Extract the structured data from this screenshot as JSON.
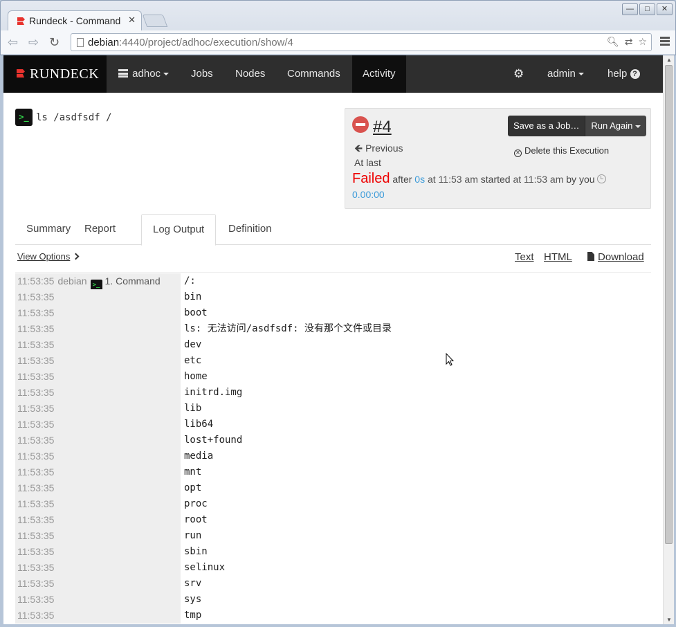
{
  "browser": {
    "tab_title": "Rundeck - Command",
    "url_host": "debian",
    "url_rest": ":4440/project/adhoc/execution/show/4"
  },
  "navbar": {
    "brand": "RUNDECK",
    "project": "adhoc",
    "items": [
      "Jobs",
      "Nodes",
      "Commands",
      "Activity"
    ],
    "admin": "admin",
    "help": "help"
  },
  "command": {
    "icon_text": ">_",
    "text": "ls /asdfsdf /"
  },
  "execution": {
    "number": "#4",
    "previous": "Previous",
    "at_last": "At last",
    "status": "Failed",
    "after": "after",
    "duration": "0s",
    "at_time": "at 11:53 am",
    "started": "started",
    "started_time": "at 11:53 am",
    "by": "by you",
    "elapsed": "0.00:00",
    "save_as_job": "Save as a Job…",
    "run_again": "Run Again",
    "delete": "Delete this Execution"
  },
  "tabs": [
    "Summary",
    "Report",
    "Log Output",
    "Definition"
  ],
  "log_options": {
    "view_options": "View Options",
    "text": "Text",
    "html": "HTML",
    "download": "Download"
  },
  "log": {
    "first": {
      "time": "11:53:35",
      "node": "debian",
      "step": "1. Command",
      "text": "/:"
    },
    "rows": [
      {
        "time": "11:53:35",
        "text": "bin"
      },
      {
        "time": "11:53:35",
        "text": "boot"
      },
      {
        "time": "11:53:35",
        "text": "ls: 无法访问/asdfsdf: 没有那个文件或目录"
      },
      {
        "time": "11:53:35",
        "text": "dev"
      },
      {
        "time": "11:53:35",
        "text": "etc"
      },
      {
        "time": "11:53:35",
        "text": "home"
      },
      {
        "time": "11:53:35",
        "text": "initrd.img"
      },
      {
        "time": "11:53:35",
        "text": "lib"
      },
      {
        "time": "11:53:35",
        "text": "lib64"
      },
      {
        "time": "11:53:35",
        "text": "lost+found"
      },
      {
        "time": "11:53:35",
        "text": "media"
      },
      {
        "time": "11:53:35",
        "text": "mnt"
      },
      {
        "time": "11:53:35",
        "text": "opt"
      },
      {
        "time": "11:53:35",
        "text": "proc"
      },
      {
        "time": "11:53:35",
        "text": "root"
      },
      {
        "time": "11:53:35",
        "text": "run"
      },
      {
        "time": "11:53:35",
        "text": "sbin"
      },
      {
        "time": "11:53:35",
        "text": "selinux"
      },
      {
        "time": "11:53:35",
        "text": "srv"
      },
      {
        "time": "11:53:35",
        "text": "sys"
      },
      {
        "time": "11:53:35",
        "text": "tmp"
      }
    ]
  },
  "colors": {
    "failed": "#ee0000",
    "link_blue": "#3a9ad9",
    "navbar": "#2e2e2e",
    "brand_bg": "#0c0c0c",
    "terminal_green": "#32d74b"
  }
}
